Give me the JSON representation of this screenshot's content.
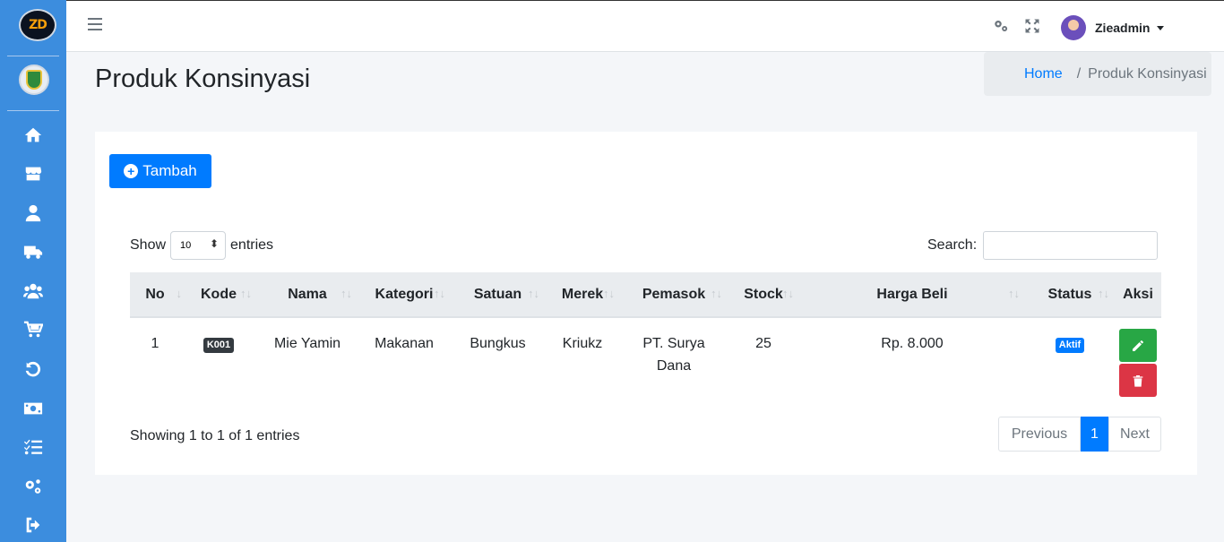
{
  "brand": {
    "logo_text": "ZD"
  },
  "sidebar": {
    "icons": [
      "home-icon",
      "store-icon",
      "user-icon",
      "truck-icon",
      "users-icon",
      "cart-icon",
      "undo-icon",
      "money-icon",
      "tasks-icon",
      "cogs-icon",
      "logout-icon"
    ]
  },
  "topbar": {
    "user_name": "Zieadmin"
  },
  "header": {
    "title": "Produk Konsinyasi",
    "breadcrumb_home": "Home",
    "breadcrumb_sep": "/",
    "breadcrumb_current": "Produk Konsinyasi"
  },
  "card": {
    "add_button": "Tambah",
    "show_label": "Show",
    "entries_label": "entries",
    "page_length": "10",
    "search_label": "Search:",
    "search_value": ""
  },
  "table": {
    "columns": [
      "No",
      "Kode",
      "Nama",
      "Kategori",
      "Satuan",
      "Merek",
      "Pemasok",
      "Stock",
      "Harga Beli",
      "Status",
      "Aksi"
    ],
    "rows": [
      {
        "no": "1",
        "kode": "K001",
        "nama": "Mie Yamin",
        "kategori": "Makanan",
        "satuan": "Bungkus",
        "merek": "Kriukz",
        "pemasok": "PT. Surya Dana",
        "stock": "25",
        "harga_beli": "Rp. 8.000",
        "status": "Aktif"
      }
    ]
  },
  "footer": {
    "info": "Showing 1 to 1 of 1 entries",
    "prev": "Previous",
    "page": "1",
    "next": "Next"
  }
}
